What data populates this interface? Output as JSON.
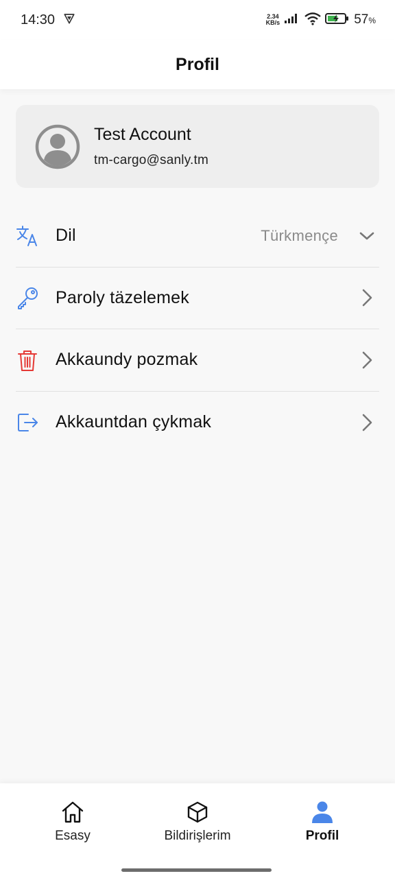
{
  "status_bar": {
    "time": "14:30",
    "net_rate_value": "2.34",
    "net_rate_unit": "KB/s",
    "battery_value": "57",
    "battery_unit": "%"
  },
  "header": {
    "title": "Profil"
  },
  "account": {
    "name": "Test Account",
    "email": "tm-cargo@sanly.tm"
  },
  "menu": {
    "items": [
      {
        "label": "Dil",
        "value": "Türkmençe",
        "icon": "translate-icon",
        "trailing": "chevron-down-icon"
      },
      {
        "label": "Paroly täzelemek",
        "icon": "key-icon",
        "trailing": "chevron-right-icon"
      },
      {
        "label": "Akkaundy pozmak",
        "icon": "trash-icon",
        "trailing": "chevron-right-icon"
      },
      {
        "label": "Akkauntdan çykmak",
        "icon": "logout-icon",
        "trailing": "chevron-right-icon"
      }
    ]
  },
  "bottom_nav": {
    "items": [
      {
        "label": "Esasy",
        "icon": "home-icon",
        "active": false
      },
      {
        "label": "Bildirişlerim",
        "icon": "box-icon",
        "active": false
      },
      {
        "label": "Profil",
        "icon": "person-icon",
        "active": true
      }
    ]
  },
  "colors": {
    "accent": "#4a86e8",
    "danger": "#e53935",
    "icon_gray": "#8e8e8e",
    "card_bg": "#eeeeee"
  }
}
